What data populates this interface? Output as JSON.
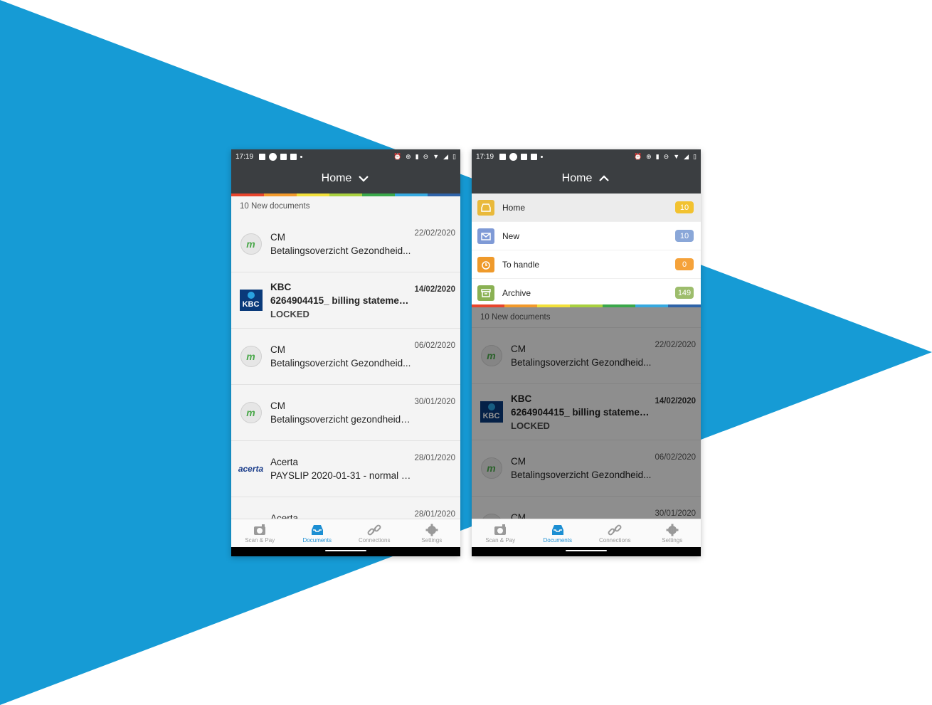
{
  "status": {
    "time": "17:19"
  },
  "left": {
    "header_title": "Home",
    "subheader": "10 New documents",
    "items": [
      {
        "logo": "cm",
        "sender": "CM",
        "subject": "Betalingsoverzicht Gezondheid...",
        "date": "22/02/2020",
        "locked": "",
        "bold": false
      },
      {
        "logo": "kbc",
        "sender": "KBC",
        "subject": "6264904415_ billing statement...",
        "date": "14/02/2020",
        "locked": "LOCKED",
        "bold": true
      },
      {
        "logo": "cm",
        "sender": "CM",
        "subject": "Betalingsoverzicht Gezondheid...",
        "date": "06/02/2020",
        "locked": "",
        "bold": false
      },
      {
        "logo": "cm",
        "sender": "CM",
        "subject": "Betalingsoverzicht gezondheids...",
        "date": "30/01/2020",
        "locked": "",
        "bold": false
      },
      {
        "logo": "acerta",
        "sender": "Acerta",
        "subject": "PAYSLIP  2020-01-31 - normal c...",
        "date": "28/01/2020",
        "locked": "",
        "bold": false
      },
      {
        "logo": "acerta",
        "sender": "Acerta",
        "subject": "",
        "date": "28/01/2020",
        "locked": "",
        "bold": false
      }
    ]
  },
  "right": {
    "header_title": "Home",
    "menu": [
      {
        "label": "Home",
        "count": "10",
        "color": "#e9b93a",
        "badge": "#f2c230",
        "icon": "inbox-icon"
      },
      {
        "label": "New",
        "count": "10",
        "color": "#7f9ad6",
        "badge": "#8aa7d8",
        "icon": "envelope-icon"
      },
      {
        "label": "To handle",
        "count": "0",
        "color": "#ef9a2b",
        "badge": "#f5a23a",
        "icon": "alarm-icon"
      },
      {
        "label": "Archive",
        "count": "149",
        "color": "#8ab153",
        "badge": "#9dbd6c",
        "icon": "archive-icon"
      }
    ],
    "subheader": "10 New documents",
    "items": [
      {
        "logo": "cm",
        "sender": "CM",
        "subject": "Betalingsoverzicht Gezondheid...",
        "date": "22/02/2020",
        "locked": "",
        "bold": false
      },
      {
        "logo": "kbc",
        "sender": "KBC",
        "subject": "6264904415_ billing statement...",
        "date": "14/02/2020",
        "locked": "LOCKED",
        "bold": true
      },
      {
        "logo": "cm",
        "sender": "CM",
        "subject": "Betalingsoverzicht Gezondheid...",
        "date": "06/02/2020",
        "locked": "",
        "bold": false
      },
      {
        "logo": "cm",
        "sender": "CM",
        "subject": "",
        "date": "30/01/2020",
        "locked": "",
        "bold": false
      }
    ]
  },
  "logos": {
    "cm": "m",
    "kbc": "KBC",
    "acerta": "acerta"
  },
  "nav": [
    {
      "label": "Scan & Pay",
      "icon": "camera-icon",
      "active": false
    },
    {
      "label": "Documents",
      "icon": "inbox-icon",
      "active": true
    },
    {
      "label": "Connections",
      "icon": "link-icon",
      "active": false
    },
    {
      "label": "Settings",
      "icon": "gear-icon",
      "active": false
    }
  ],
  "colors": {
    "background_triangle": "#169bd5",
    "bar": "#3b3e41",
    "accent": "#1c8fd3",
    "rainbow": [
      "#e8452c",
      "#f39a2b",
      "#f2e03a",
      "#a9d13f",
      "#3aa84a",
      "#36a9e0",
      "#2f63a8"
    ]
  }
}
